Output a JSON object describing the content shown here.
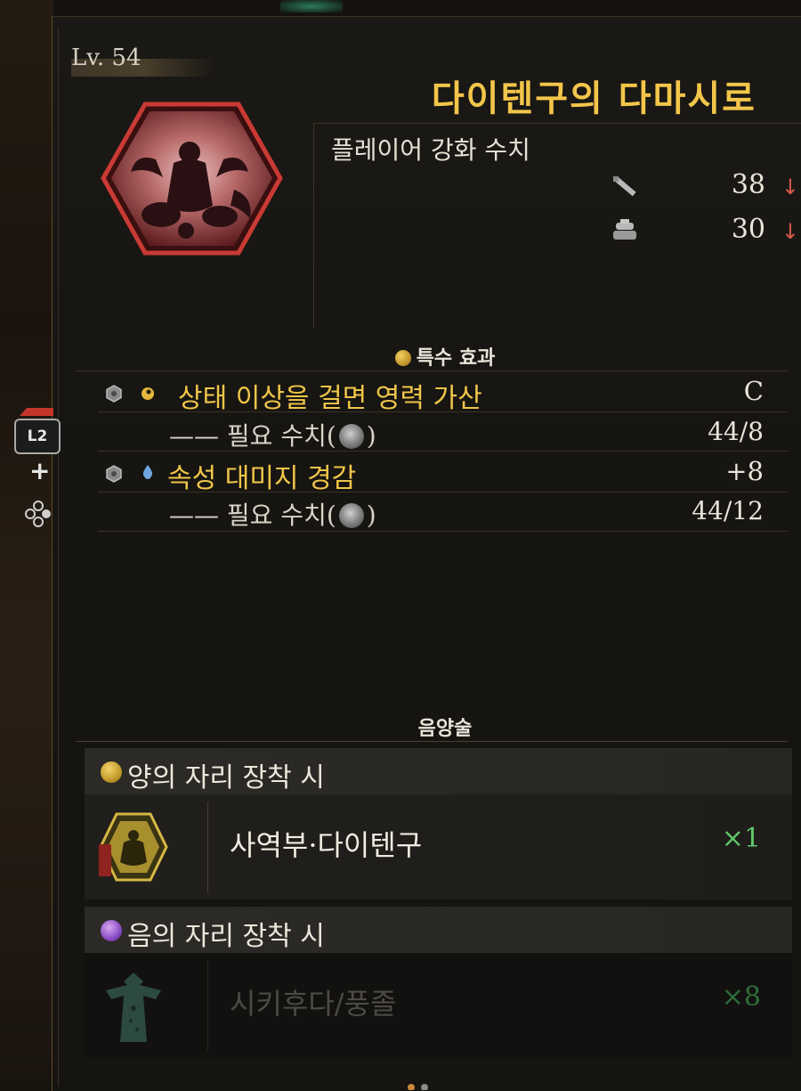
{
  "header": {
    "level": "Lv. 54",
    "title": "다이텐구의 다마시로",
    "subtitle": "플레이어 강화 수치"
  },
  "stats": [
    {
      "icon": "sword-icon",
      "value": "38",
      "arrow": "↓"
    },
    {
      "icon": "armor-icon",
      "value": "30",
      "arrow": "↓"
    }
  ],
  "special": {
    "title": "특수 효과",
    "effects": [
      {
        "gem_icon": "gray-gem-icon",
        "element_icon": "yin-yang-yellow-icon",
        "label": "상태 이상을 걸면 영력 가산",
        "value": "C",
        "req_label": "—— 필요 수치(",
        "req_close": ")",
        "req_value": "44/8"
      },
      {
        "gem_icon": "gray-gem-icon",
        "element_icon": "water-drop-icon",
        "label": "속성 대미지 경감",
        "value": "+8",
        "req_label": "—— 필요 수치(",
        "req_close": ")",
        "req_value": "44/12"
      }
    ]
  },
  "onmyo": {
    "title": "음양술",
    "yang_header": "양의 자리 장착 시",
    "yang_item": {
      "name": "사역부·다이텐구",
      "count": "×1"
    },
    "yin_header": "음의 자리 장착 시",
    "yin_item": {
      "name": "시키후다/풍졸",
      "count": "×8"
    }
  },
  "controls": {
    "l2": "L2",
    "plus": "+"
  },
  "colors": {
    "title_gold": "#f3c64a",
    "count_green": "#5fc86a",
    "arrow_red": "#d45a48"
  }
}
